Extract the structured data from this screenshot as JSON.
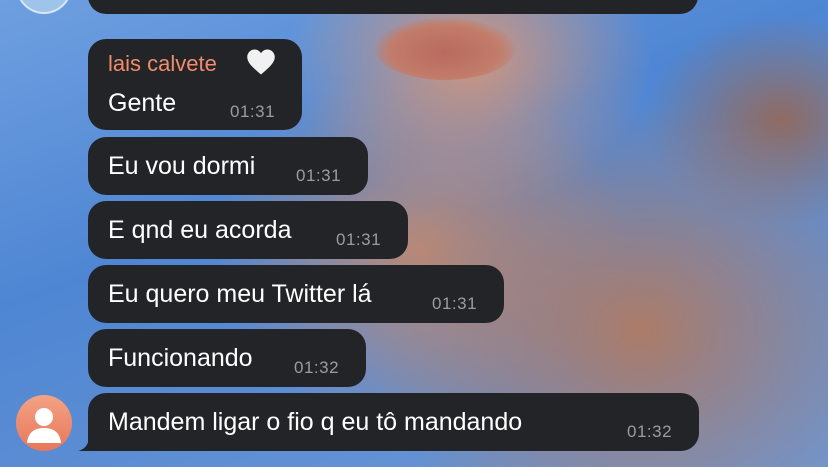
{
  "chat": {
    "sender_name": "lais calvete",
    "sender_emoji": "white-heart-icon",
    "accent_color": "#f08c6c",
    "bubble_color": "#232427",
    "messages": [
      {
        "text": "Gente",
        "time": "01:31"
      },
      {
        "text": "Eu vou dormi",
        "time": "01:31"
      },
      {
        "text": "E qnd eu acorda",
        "time": "01:31"
      },
      {
        "text": "Eu quero meu Twitter lá",
        "time": "01:31"
      },
      {
        "text": "Funcionando",
        "time": "01:32"
      },
      {
        "text": "Mandem ligar o fio q eu tô mandando",
        "time": "01:32"
      }
    ]
  }
}
